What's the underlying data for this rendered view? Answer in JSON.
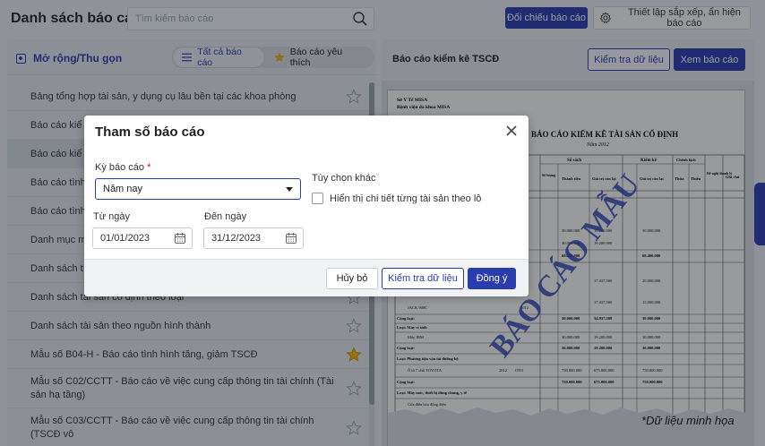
{
  "header": {
    "title": "Danh sách báo cáo",
    "search_placeholder": "Tìm kiếm báo cáo",
    "compare_button": "Đối chiếu báo cáo",
    "settings_button": "Thiết lập sắp xếp, ẩn hiện báo cáo"
  },
  "left": {
    "expand_label": "Mở rộng/Thu gọn",
    "filter_all": "Tất cả báo cáo",
    "filter_fav": "Báo cáo yêu thích",
    "items": [
      {
        "label": "Bảng tổng hợp tài sản, y dụng cụ lâu bền tại các khoa phòng",
        "fav": false
      },
      {
        "label": "Báo cáo kiể",
        "fav": false
      },
      {
        "label": "Báo cáo kiể",
        "fav": false,
        "selected": true
      },
      {
        "label": "Báo cáo tình",
        "fav": false
      },
      {
        "label": "Báo cáo tình",
        "fav": false
      },
      {
        "label": "Danh mục m",
        "fav": false
      },
      {
        "label": "Danh sách t",
        "fav": false
      },
      {
        "label": "Danh sách tài sản cố định theo loại",
        "fav": false
      },
      {
        "label": "Danh sách tài sản theo nguồn hình thành",
        "fav": false
      },
      {
        "label": "Mẫu số B04-H - Báo cáo tình hình tăng, giảm TSCĐ",
        "fav": true
      },
      {
        "label": "Mẫu số C02/CCTT - Báo cáo về việc cung cấp thông tin tài chính (Tài sản hạ tầng)",
        "fav": false
      },
      {
        "label": "Mẫu số C03/CCTT - Báo cáo về việc cung cấp thông tin tài chính (TSCĐ vô",
        "fav": false
      }
    ]
  },
  "right": {
    "preview_title": "Báo cáo kiểm kê TSCĐ",
    "check_button": "Kiểm tra dữ liệu",
    "view_button": "Xem báo cáo",
    "doc": {
      "org1": "Sở Y Tế MISA",
      "org2": "Bệnh viện đa khoa MISA",
      "heading": "BÁO CÁO KIỂM KÊ TÀI SẢN CỐ ĐỊNH",
      "year": "Năm 2012",
      "col_so_sach": "Số sách",
      "col_kiem_ke": "Kiểm kê",
      "col_chenh_lech": "Chênh lệch",
      "col_so_luong": "Số lượng",
      "col_thanh_tien": "Thành tiền",
      "col_gtcl": "Giá trị còn lại",
      "col_thua": "Thừa",
      "col_thieu": "Thiếu",
      "col_de_nghi": "Đề nghị thanh lý",
      "col_ghi_chu": "Ghi chú",
      "row_cong_loai": "Cộng loại:",
      "row_loai_may_vi_tinh": "Loại: Máy vi tính",
      "row_loai_ptvt": "Loại: Phương tiện vận tải đường bộ",
      "row_loai_may_moc": "Loại: Máy móc, thiết bị dùng chung, y tế",
      "row_jack": "JACK 900C",
      "row_may_ibm": "Máy IBM",
      "row_oto": "Ô tô 7 chỗ TOYOTA",
      "row_cua_kho": "Cửa điều hòa động điện",
      "watermark": "BÁO CÁO MẪU",
      "v_30000": "30.000.000",
      "v_60000": "60.000.000",
      "v_68400": "68.400.000",
      "v_19200": "19.200.000",
      "v_34937": "34.937.500",
      "v_750000": "750.000.000",
      "v_675000": "675.000.000",
      "v_20000": "20.000.000",
      "v_17437": "17.437.500",
      "v_15000": "15.000.000",
      "v_2012": "2012",
      "v_oto": "OTO"
    },
    "disclaimer": "*Dữ liệu minh họa"
  },
  "modal": {
    "title": "Tham số báo cáo",
    "period_label": "Kỳ báo cáo",
    "period_required": "*",
    "period_value": "Năm nay",
    "other_options_label": "Tùy chọn khác",
    "option_detail_label": "Hiển thị chi tiết từng tài sản theo lô",
    "from_label": "Từ ngày",
    "from_value": "01/01/2023",
    "to_label": "Đến ngày",
    "to_value": "31/12/2023",
    "cancel_button": "Hủy bỏ",
    "check_button": "Kiểm tra dữ liệu",
    "ok_button": "Đồng ý"
  },
  "colors": {
    "primary": "#2a3cae",
    "star_fav": "#f2b705"
  }
}
